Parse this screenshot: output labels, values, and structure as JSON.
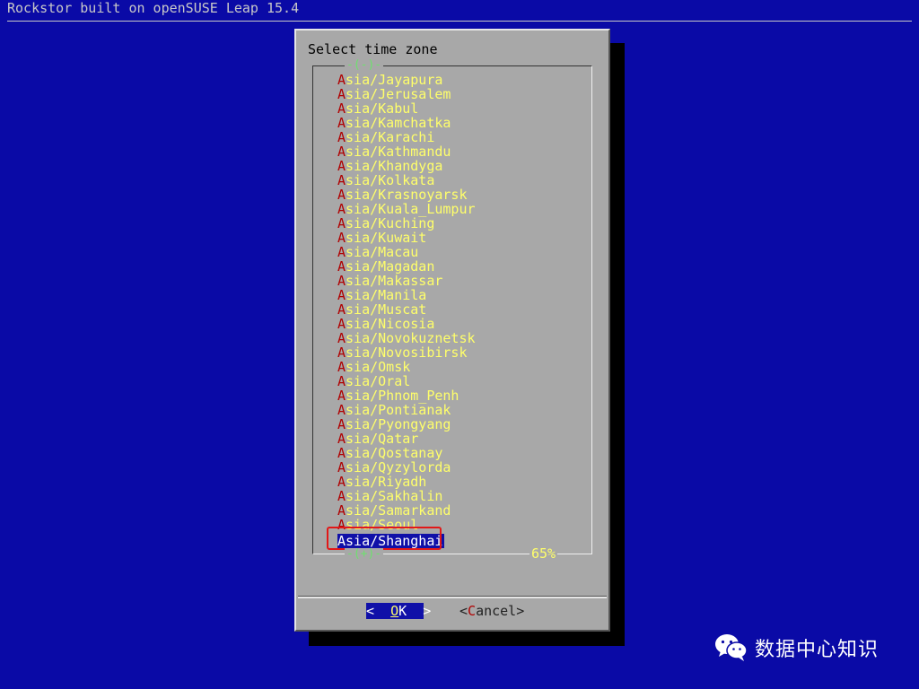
{
  "backtitle": "Rockstor built on openSUSE Leap 15.4",
  "dialog": {
    "title": "Select time zone",
    "scroll_up_indicator": "-(-)-",
    "scroll_down_indicator": "-(+)-",
    "scroll_percent": "65%",
    "items": [
      {
        "hot": "A",
        "rest": "sia/Jayapura"
      },
      {
        "hot": "A",
        "rest": "sia/Jerusalem"
      },
      {
        "hot": "A",
        "rest": "sia/Kabul"
      },
      {
        "hot": "A",
        "rest": "sia/Kamchatka"
      },
      {
        "hot": "A",
        "rest": "sia/Karachi"
      },
      {
        "hot": "A",
        "rest": "sia/Kathmandu"
      },
      {
        "hot": "A",
        "rest": "sia/Khandyga"
      },
      {
        "hot": "A",
        "rest": "sia/Kolkata"
      },
      {
        "hot": "A",
        "rest": "sia/Krasnoyarsk"
      },
      {
        "hot": "A",
        "rest": "sia/Kuala_Lumpur"
      },
      {
        "hot": "A",
        "rest": "sia/Kuching"
      },
      {
        "hot": "A",
        "rest": "sia/Kuwait"
      },
      {
        "hot": "A",
        "rest": "sia/Macau"
      },
      {
        "hot": "A",
        "rest": "sia/Magadan"
      },
      {
        "hot": "A",
        "rest": "sia/Makassar"
      },
      {
        "hot": "A",
        "rest": "sia/Manila"
      },
      {
        "hot": "A",
        "rest": "sia/Muscat"
      },
      {
        "hot": "A",
        "rest": "sia/Nicosia"
      },
      {
        "hot": "A",
        "rest": "sia/Novokuznetsk"
      },
      {
        "hot": "A",
        "rest": "sia/Novosibirsk"
      },
      {
        "hot": "A",
        "rest": "sia/Omsk"
      },
      {
        "hot": "A",
        "rest": "sia/Oral"
      },
      {
        "hot": "A",
        "rest": "sia/Phnom_Penh"
      },
      {
        "hot": "A",
        "rest": "sia/Pontianak"
      },
      {
        "hot": "A",
        "rest": "sia/Pyongyang"
      },
      {
        "hot": "A",
        "rest": "sia/Qatar"
      },
      {
        "hot": "A",
        "rest": "sia/Qostanay"
      },
      {
        "hot": "A",
        "rest": "sia/Qyzylorda"
      },
      {
        "hot": "A",
        "rest": "sia/Riyadh"
      },
      {
        "hot": "A",
        "rest": "sia/Sakhalin"
      },
      {
        "hot": "A",
        "rest": "sia/Samarkand"
      },
      {
        "hot": "A",
        "rest": "sia/Seoul"
      },
      {
        "hot": "A",
        "rest": "sia/Shanghai"
      }
    ],
    "selected_item": "Asia/Shanghai",
    "ok_button": {
      "left": "<",
      "hot": "O",
      "rest": "K",
      "right": ">"
    },
    "cancel_button": {
      "left": "<",
      "hot": "C",
      "rest": "ancel",
      "right": ">"
    }
  },
  "watermark": {
    "text": "数据中心知识",
    "icon": "wechat-icon"
  },
  "colors": {
    "background": "#0a0aa6",
    "dialog": "#a8a8a8",
    "item_text": "#ffff6a",
    "hotkey": "#b00000",
    "selection": "#1010a8",
    "callout_border": "#e21818"
  }
}
